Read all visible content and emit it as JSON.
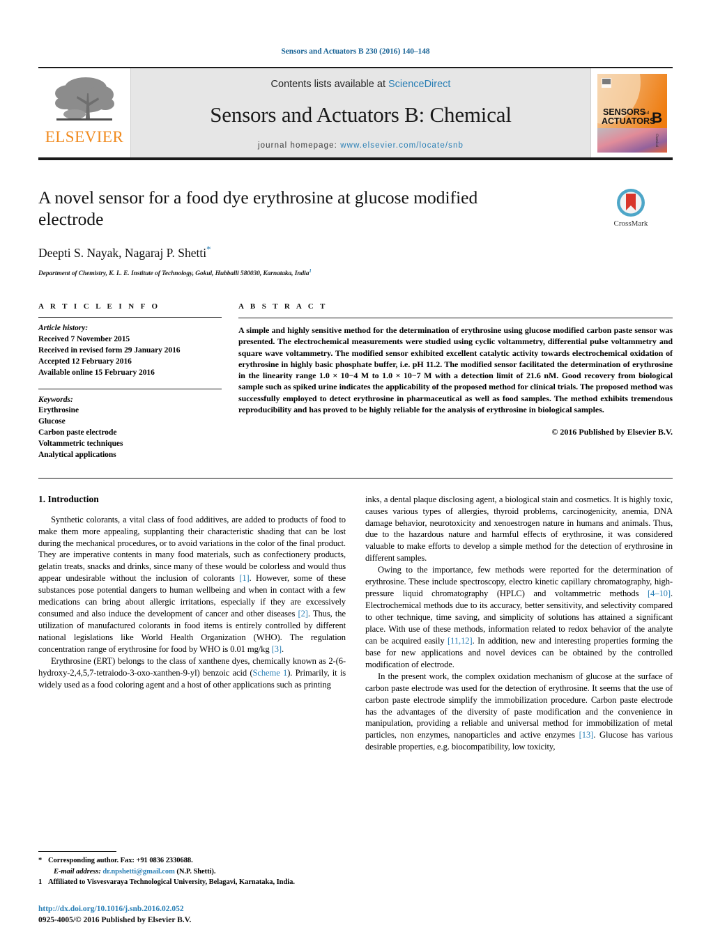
{
  "running_head": "Sensors and Actuators B 230 (2016) 140–148",
  "masthead": {
    "publisher_name": "ELSEVIER",
    "contents_prefix": "Contents lists available at ",
    "contents_link": "ScienceDirect",
    "journal_title": "Sensors and Actuators B: Chemical",
    "homepage_prefix": "journal homepage: ",
    "homepage_url": "www.elsevier.com/locate/snb",
    "cover_line1": "SENSORS",
    "cover_and": "and",
    "cover_line2": "ACTUATORS",
    "cover_letter": "B",
    "cover_sub": "Chemical",
    "accent_orange": "#f08a1e",
    "link_blue": "#2a7fb5"
  },
  "article": {
    "title": "A novel sensor for a food dye erythrosine at glucose modified electrode",
    "authors": "Deepti S. Nayak, Nagaraj P. Shetti",
    "author_marker": "*",
    "affiliation": "Department of Chemistry, K. L. E. Institute of Technology, Gokul, Hubballi 580030, Karnataka, India",
    "affiliation_marker": "1",
    "crossmark_label": "CrossMark"
  },
  "info": {
    "heading": "A R T I C L E   I N F O",
    "history_label": "Article history:",
    "history": [
      "Received 7 November 2015",
      "Received in revised form 29 January 2016",
      "Accepted 12 February 2016",
      "Available online 15 February 2016"
    ],
    "keywords_label": "Keywords:",
    "keywords": [
      "Erythrosine",
      "Glucose",
      "Carbon paste electrode",
      "Voltammetric techniques",
      "Analytical applications"
    ]
  },
  "abstract": {
    "heading": "A B S T R A C T",
    "text": "A simple and highly sensitive method for the determination of erythrosine using glucose modified carbon paste sensor was presented. The electrochemical measurements were studied using cyclic voltammetry, differential pulse voltammetry and square wave voltammetry. The modified sensor exhibited excellent catalytic activity towards electrochemical oxidation of erythrosine in highly basic phosphate buffer, i.e. pH 11.2. The modified sensor facilitated the determination of erythrosine in the linearity range 1.0 × 10−4 M to 1.0 × 10−7 M with a detection limit of 21.6 nM. Good recovery from biological sample such as spiked urine indicates the applicability of the proposed method for clinical trials. The proposed method was successfully employed to detect erythrosine in pharmaceutical as well as food samples. The method exhibits tremendous reproducibility and has proved to be highly reliable for the analysis of erythrosine in biological samples.",
    "copyright": "© 2016 Published by Elsevier B.V."
  },
  "introduction": {
    "section_number_title": "1.  Introduction",
    "left_paragraphs": [
      "Synthetic colorants, a vital class of food additives, are added to products of food to make them more appealing, supplanting their characteristic shading that can be lost during the mechanical procedures, or to avoid variations in the color of the final product. They are imperative contents in many food materials, such as confectionery products, gelatin treats, snacks and drinks, since many of these would be colorless and would thus appear undesirable without the inclusion of colorants [1]. However, some of these substances pose potential dangers to human wellbeing and when in contact with a few medications can bring about allergic irritations, especially if they are excessively consumed and also induce the development of cancer and other diseases [2]. Thus, the utilization of manufactured colorants in food items is entirely controlled by different national legislations like World Health Organization (WHO). The regulation concentration range of erythrosine for food by WHO is 0.01 mg/kg [3].",
      "Erythrosine (ERT) belongs to the class of xanthene dyes, chemically known as 2-(6-hydroxy-2,4,5,7-tetraiodo-3-oxo-xanthen-9-yl) benzoic acid (Scheme 1). Primarily, it is widely used as a food coloring agent and a host of other applications such as printing"
    ],
    "right_paragraphs": [
      "inks, a dental plaque disclosing agent, a biological stain and cosmetics. It is highly toxic, causes various types of allergies, thyroid problems, carcinogenicity, anemia, DNA damage behavior, neurotoxicity and xenoestrogen nature in humans and animals. Thus, due to the hazardous nature and harmful effects of erythrosine, it was considered valuable to make efforts to develop a simple method for the detection of erythrosine in different samples.",
      "Owing to the importance, few methods were reported for the determination of erythrosine. These include spectroscopy, electro kinetic capillary chromatography, high-pressure liquid chromatography (HPLC) and voltammetric methods [4–10]. Electrochemical methods due to its accuracy, better sensitivity, and selectivity compared to other technique, time saving, and simplicity of solutions has attained a significant place. With use of these methods, information related to redox behavior of the analyte can be acquired easily [11,12]. In addition, new and interesting properties forming the base for new applications and novel devices can be obtained by the controlled modification of electrode.",
      "In the present work, the complex oxidation mechanism of glucose at the surface of carbon paste electrode was used for the detection of erythrosine. It seems that the use of carbon paste electrode simplify the immobilization procedure. Carbon paste electrode has the advantages of the diversity of paste modification and the convenience in manipulation, providing a reliable and universal method for immobilization of metal particles, non enzymes, nanoparticles and active enzymes [13]. Glucose has various desirable properties, e.g. biocompatibility, low toxicity,"
    ]
  },
  "footnotes": {
    "corresponding": "Corresponding author. Fax: +91 0836 2330688.",
    "corresponding_mark": "*",
    "email_label": "E-mail address:",
    "email": "dr.npshetti@gmail.com",
    "email_suffix": "(N.P. Shetti).",
    "affiliation_mark": "1",
    "affiliation_note": "Affiliated to Visvesvaraya Technological University, Belagavi, Karnataka, India."
  },
  "doi_block": {
    "doi": "http://dx.doi.org/10.1016/j.snb.2016.02.052",
    "issn": "0925-4005/© 2016 Published by Elsevier B.V."
  }
}
